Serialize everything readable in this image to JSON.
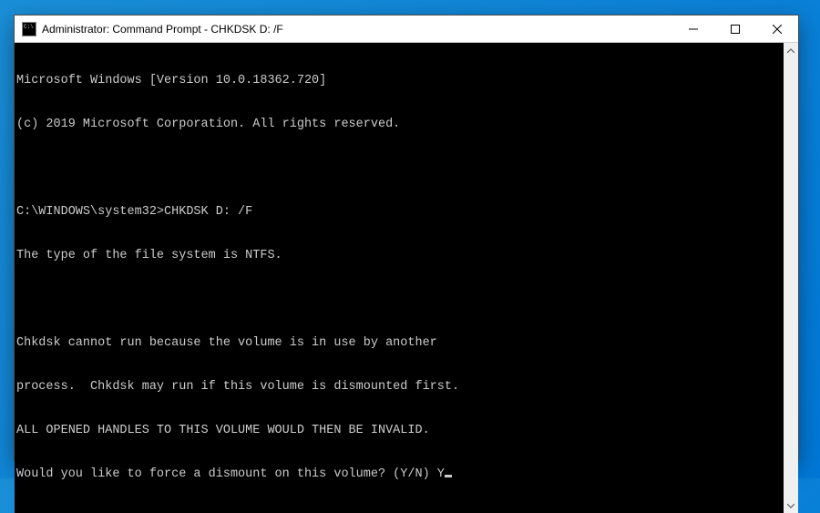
{
  "window": {
    "title": "Administrator: Command Prompt - CHKDSK  D: /F"
  },
  "terminal": {
    "lines": [
      "Microsoft Windows [Version 10.0.18362.720]",
      "(c) 2019 Microsoft Corporation. All rights reserved.",
      "",
      "C:\\WINDOWS\\system32>CHKDSK D: /F",
      "The type of the file system is NTFS.",
      "",
      "Chkdsk cannot run because the volume is in use by another",
      "process.  Chkdsk may run if this volume is dismounted first.",
      "ALL OPENED HANDLES TO THIS VOLUME WOULD THEN BE INVALID.",
      "Would you like to force a dismount on this volume? (Y/N) Y"
    ]
  }
}
